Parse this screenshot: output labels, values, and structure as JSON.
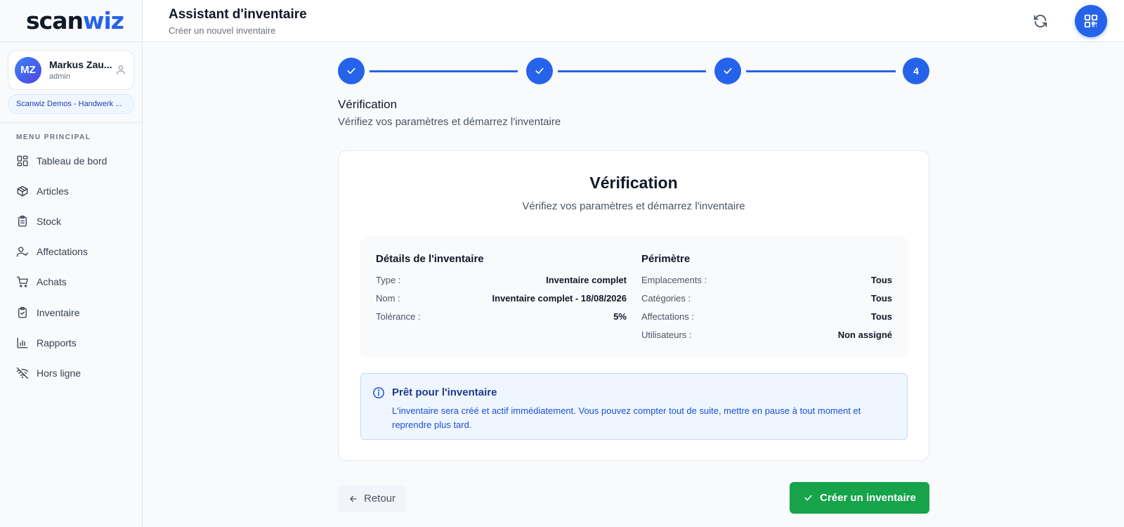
{
  "brand": {
    "logo_part1": "scan",
    "logo_part2": "wiz"
  },
  "user": {
    "initials": "MZ",
    "name": "Markus Zau...",
    "role": "admin",
    "organization": "Scanwiz Demos - Handwerk ..."
  },
  "sidebar": {
    "menu_title": "MENU PRINCIPAL",
    "items": [
      {
        "label": "Tableau de bord",
        "icon": "dashboard-icon"
      },
      {
        "label": "Articles",
        "icon": "box-icon"
      },
      {
        "label": "Stock",
        "icon": "clipboard-list-icon"
      },
      {
        "label": "Affectations",
        "icon": "user-check-icon"
      },
      {
        "label": "Achats",
        "icon": "cart-icon"
      },
      {
        "label": "Inventaire",
        "icon": "clipboard-check-icon"
      },
      {
        "label": "Rapports",
        "icon": "bar-chart-icon"
      },
      {
        "label": "Hors ligne",
        "icon": "wifi-off-icon"
      }
    ]
  },
  "header": {
    "title": "Assistant d'inventaire",
    "subtitle": "Créer un nouvel inventaire"
  },
  "stepper": {
    "steps": [
      "✓",
      "✓",
      "✓",
      "4"
    ],
    "current_step": 4,
    "total_steps": 4
  },
  "step": {
    "title": "Vérification",
    "subtitle": "Vérifiez vos paramètres et démarrez l'inventaire"
  },
  "card": {
    "title": "Vérification",
    "subtitle": "Vérifiez vos paramètres et démarrez l'inventaire",
    "details": {
      "title": "Détails de l'inventaire",
      "rows": [
        {
          "label": "Type :",
          "value": "Inventaire complet"
        },
        {
          "label": "Nom :",
          "value": "Inventaire complet - 18/08/2026"
        },
        {
          "label": "Tolérance :",
          "value": "5%"
        }
      ]
    },
    "scope": {
      "title": "Périmètre",
      "rows": [
        {
          "label": "Emplacements :",
          "value": "Tous"
        },
        {
          "label": "Catégories :",
          "value": "Tous"
        },
        {
          "label": "Affectations :",
          "value": "Tous"
        },
        {
          "label": "Utilisateurs :",
          "value": "Non assigné"
        }
      ]
    },
    "info": {
      "title": "Prêt pour l'inventaire",
      "text": "L'inventaire sera créé et actif immédiatement. Vous pouvez compter tout de suite, mettre en pause à tout moment et reprendre plus tard."
    }
  },
  "actions": {
    "back": "Retour",
    "create": "Créer un inventaire"
  },
  "colors": {
    "accent": "#2563eb",
    "success": "#16a34a",
    "info_bg": "#eff6ff"
  }
}
